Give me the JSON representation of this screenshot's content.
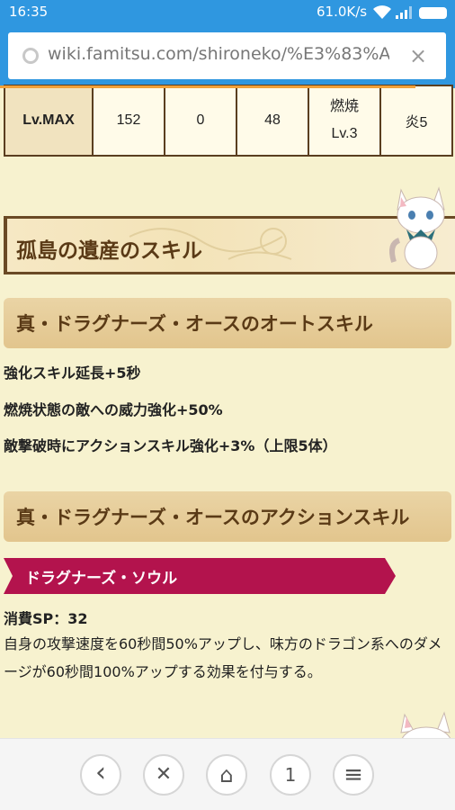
{
  "status_bar": {
    "time": "16:35",
    "net_speed": "61.0K/s"
  },
  "browser": {
    "url": "wiki.famitsu.com/shironeko/%E3%83%A2%",
    "close_glyph": "×"
  },
  "stats_row": {
    "level": "Lv.MAX",
    "v1": "152",
    "v2": "0",
    "v3": "48",
    "burn_line1": "燃焼",
    "burn_line2": "Lv.3",
    "element": "炎5"
  },
  "section_heading": "孤島の遺産のスキル",
  "auto_skill": {
    "heading": "真・ドラグナーズ・オースのオートスキル",
    "lines": [
      "強化スキル延長+5秒",
      "燃焼状態の敵への威力強化+50%",
      "敵撃破時にアクションスキル強化+3%（上限5体）"
    ]
  },
  "action_skill": {
    "heading": "真・ドラグナーズ・オースのアクションスキル",
    "name": "ドラグナーズ・ソウル",
    "sp": "消費SP：32",
    "description": "自身の攻撃速度を60秒間50%アップし、味方のドラゴン系へのダメージが60秒間100%アップする効果を付与する。"
  },
  "bottom_nav": {
    "back": "‹",
    "close": "✕",
    "home": "⌂",
    "tabs": "1",
    "menu": "≡"
  }
}
